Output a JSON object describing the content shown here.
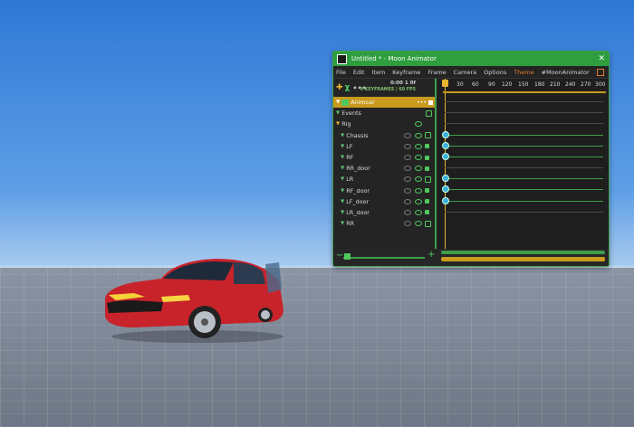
{
  "window": {
    "title": "Untitled * - Moon Animator",
    "close_label": "✕"
  },
  "menu": [
    "File",
    "Edit",
    "Item",
    "Keyframe",
    "Frame",
    "Camera",
    "Options",
    "Theme",
    "#MoonAnimator"
  ],
  "toolbar": {
    "add_label": "✚",
    "curve_label": "χ",
    "more_label": "•••",
    "time": "0:00  1  0f",
    "fps": "9 KEYFRAMES | 60 FPS"
  },
  "ruler_ticks": [
    "0",
    "30",
    "60",
    "90",
    "120",
    "150",
    "180",
    "210",
    "240",
    "270",
    "300"
  ],
  "items": [
    {
      "label": "Animcar",
      "tri": "▼",
      "selected": true,
      "tri_color": "orange"
    },
    {
      "label": "Events",
      "tri": "▼"
    },
    {
      "label": "Rig",
      "tri": "▼",
      "tri_color": "orange"
    },
    {
      "label": "Chassis",
      "tri": "▼"
    },
    {
      "label": "LF",
      "tri": "▼"
    },
    {
      "label": "RF",
      "tri": "▼"
    },
    {
      "label": "RR_door",
      "tri": "▼"
    },
    {
      "label": "LR",
      "tri": "▼"
    },
    {
      "label": "RF_door",
      "tri": "▼"
    },
    {
      "label": "LF_door",
      "tri": "▼"
    },
    {
      "label": "LR_door",
      "tri": "▼"
    },
    {
      "label": "RR",
      "tri": "▼"
    }
  ],
  "keyframe_rows": [
    "LF",
    "RF",
    "RR_door",
    "RF_door",
    "LF_door",
    "LR_door"
  ],
  "bottom": {
    "minus": "−",
    "plus": "+"
  },
  "colors": {
    "accent": "#2f9e3f",
    "orange": "#c89a1e",
    "keyframe": "#3ab0d8"
  }
}
